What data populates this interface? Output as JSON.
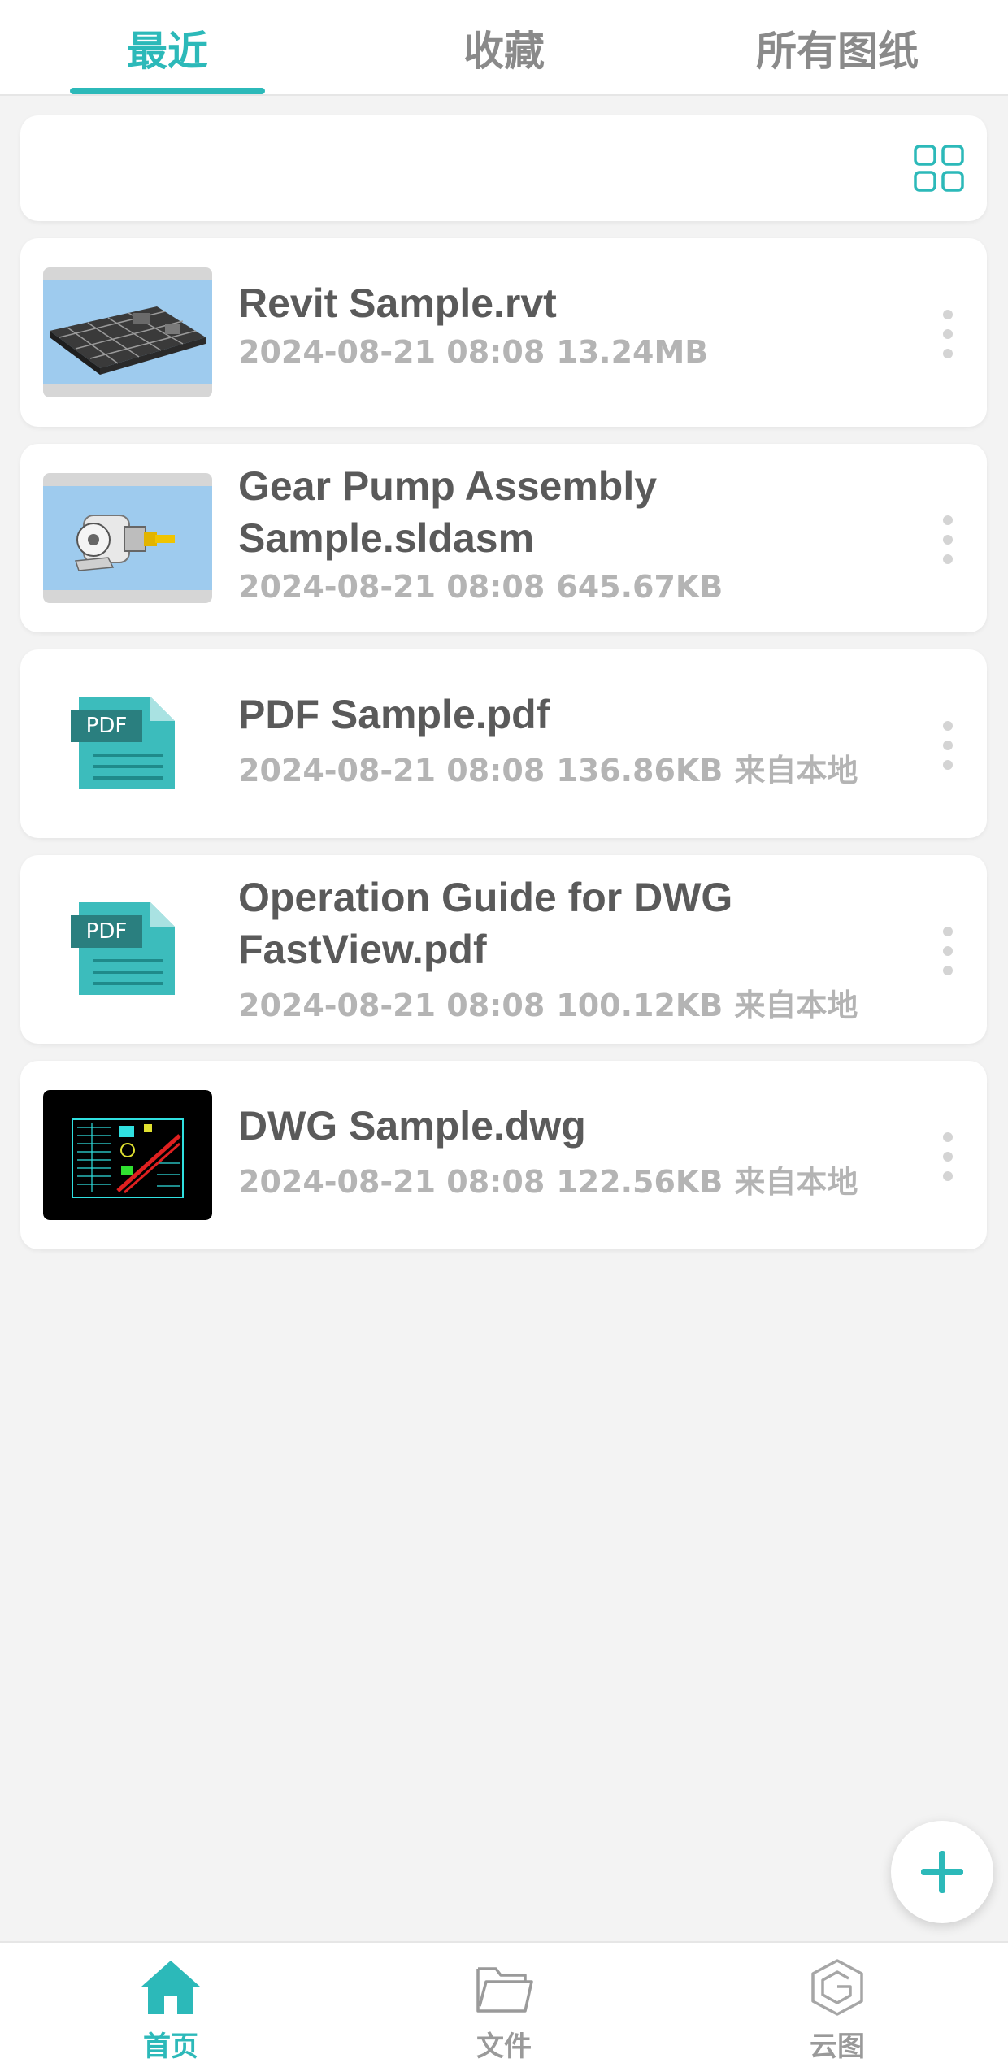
{
  "tabs": [
    {
      "label": "最近",
      "active": true
    },
    {
      "label": "收藏",
      "active": false
    },
    {
      "label": "所有图纸",
      "active": false
    }
  ],
  "toolbar": {
    "view_toggle_icon": "grid-view-icon"
  },
  "files": [
    {
      "name": "Revit Sample.rvt",
      "date": "2024-08-21 08:08",
      "size": "13.24MB",
      "source": "",
      "thumbnail": "revit-model-thumbnail"
    },
    {
      "name": "Gear Pump Assembly Sample.sldasm",
      "date": "2024-08-21 08:08",
      "size": "645.67KB",
      "source": "",
      "thumbnail": "gear-pump-thumbnail"
    },
    {
      "name": "PDF Sample.pdf",
      "date": "2024-08-21 08:08",
      "size": "136.86KB",
      "source": "来自本地",
      "thumbnail": "pdf-file-icon",
      "icon_text": "PDF"
    },
    {
      "name": "Operation Guide for DWG FastView.pdf",
      "date": "2024-08-21 08:08",
      "size": "100.12KB",
      "source": "来自本地",
      "thumbnail": "pdf-file-icon",
      "icon_text": "PDF"
    },
    {
      "name": "DWG Sample.dwg",
      "date": "2024-08-21 08:08",
      "size": "122.56KB",
      "source": "来自本地",
      "thumbnail": "dwg-drawing-thumbnail"
    }
  ],
  "fab": {
    "icon": "plus-icon"
  },
  "bottom_nav": [
    {
      "label": "首页",
      "icon": "home-icon",
      "active": true
    },
    {
      "label": "文件",
      "icon": "folder-icon",
      "active": false
    },
    {
      "label": "云图",
      "icon": "cloud-drawing-logo-icon",
      "active": false
    }
  ],
  "colors": {
    "accent": "#2cb9b9",
    "background": "#f3f3f3",
    "text_primary": "#5a5a5a",
    "text_secondary": "#b4b4b4"
  }
}
